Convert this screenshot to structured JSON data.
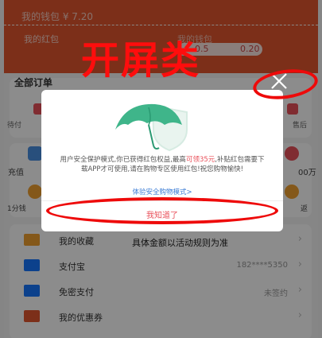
{
  "header": {
    "wallet_label": "我的钱包  ¥ 7.20",
    "redpacket_label": "我的红包",
    "right_label": "我的钱包",
    "pill_value_a": "0.5",
    "pill_value_b": "0.20"
  },
  "overlay_title": "开屏类",
  "orders": {
    "title": "全部订单",
    "left_label": "待付",
    "right_label": "售后"
  },
  "tools": {
    "left_top": "充值",
    "left_bottom": "1分钱",
    "right_top": "00万",
    "right_bottom": "返"
  },
  "modal": {
    "body_prefix": "用户安全保护模式,你已获得红包权益,最高",
    "body_highlight1": "可领35元",
    "body_suffix": ",补贴红包需要下载APP才可使用,请在购物专区使用红包!祝您购物愉快!",
    "link": "体验安全购物模式>",
    "ok": "我知道了"
  },
  "list": {
    "rows": [
      {
        "label": "我的收藏",
        "value": "",
        "note": "具体金额以活动规则为准"
      },
      {
        "label": "支付宝",
        "value": "182****5350"
      },
      {
        "label": "免密支付",
        "value": "未签约"
      },
      {
        "label": "我的优惠券",
        "value": ""
      }
    ]
  },
  "colors": {
    "brand": "#e2562f",
    "annotation": "#ee0a0a",
    "accent": "#e9505a",
    "link": "#3a7bd5"
  }
}
